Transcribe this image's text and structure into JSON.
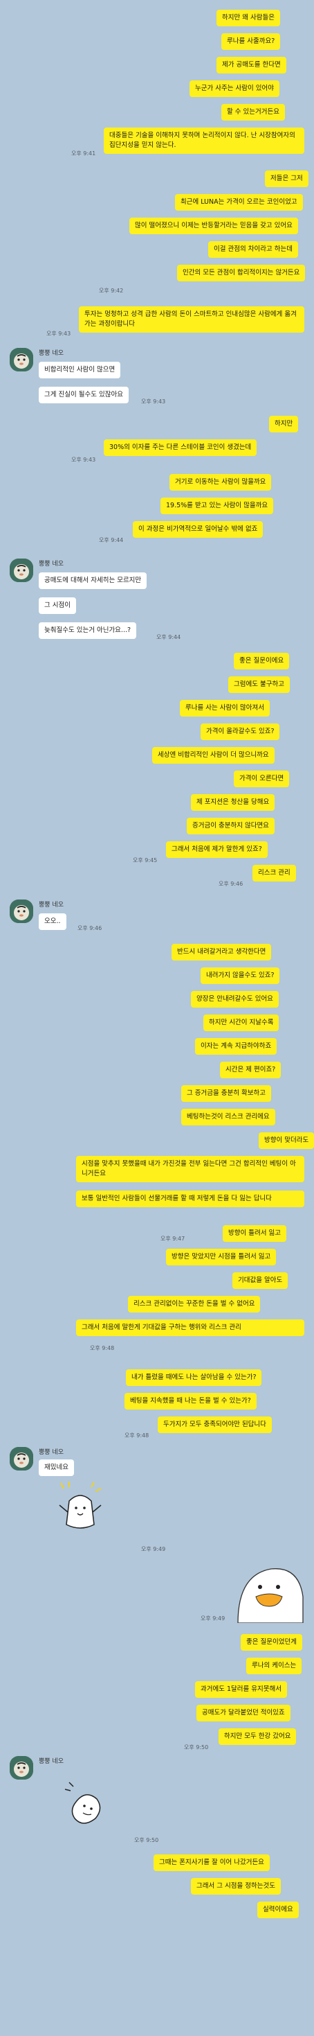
{
  "sender_name": "뿡뿡 네오",
  "times": {
    "t941": "오후 9:41",
    "t942": "오후 9:42",
    "t943": "오후 9:43",
    "t944": "오후 9:44",
    "t945": "오후 9:45",
    "t946": "오후 9:46",
    "t947": "오후 9:47",
    "t948": "오후 9:48",
    "t949": "오후 9:49",
    "t950": "오후 9:50"
  },
  "messages": {
    "m1": "하지만 왜 사람들은",
    "m2": "루나를 사줄까요?",
    "m3": "제가 공매도를 한다면",
    "m4": "누군가 사주는 사람이 있어야",
    "m5": "할 수 있는거거든요",
    "m6": "대중들은 기술을 이해하지 못하며 논리적이지 않다. 난 시장참여자의 집단지성을 믿지 않는다.",
    "m7": "저들은 그저",
    "m8": "최근에 LUNA는 가격이 오르는 코인이었고",
    "m9": "많이 떨어졌으니 이제는 반등할거라는 믿음을 갖고 있어요",
    "m10": "이걸 관점의 차이라고 하는데",
    "m11": "인간의 모든 관점이 합리적이지는 않거든요",
    "m12": "투자는 멍청하고 성격 급한 사람의 돈이 스마트하고 인내심많은 사람에게 옮겨가는 과정이랍니다",
    "o1": "비합리적인 사람이 많으면",
    "o2": "그게 진실이 될수도 있잖아요",
    "m13": "하지만",
    "m14": "30%의 이자를 주는 다른 스테이블 코인이 생겼는데",
    "m15": "거기로 이동하는 사람이 많을까요",
    "m16": "19.5%를 받고 있는 사람이 많을까요",
    "m17": "이 과정은 비가역적으로 일어날수 밖에 없죠",
    "o3": "공매도에 대해서 자세히는 모르지만",
    "o4": "그 시점이",
    "o5": "늦춰질수도 있는거 아닌가요...?",
    "m18": "좋은 질문이에요",
    "m19": "그럼에도 불구하고",
    "m20": "루나를 사는 사람이 많아져서",
    "m21": "가격이 올라갈수도 있죠?",
    "m22": "세상엔 비합리적인 사람이 더 많으니까요",
    "m23": "가격이 오른다면",
    "m24": "제 포지션은 청산을 당해요",
    "m25": "증거금이 충분하지 않다면요",
    "m26": "그래서 처음에 제가 말한게 있죠?",
    "m27": "리스크 관리",
    "o6": "오오..",
    "m28": "반드시 내려갈거라고 생각한다면",
    "m29": "내려가지 않을수도 있죠?",
    "m30": "양장은 안내려갈수도 있어요",
    "m31": "하지만 시간이 지날수록",
    "m32": "이자는 계속 지급하야하죠",
    "m33": "시간은 제 편이죠?",
    "m34": "그 증거금을 충분히 확보하고",
    "m35": "베팅하는것이 리스크 관리에요",
    "m36": "방향이 맞더라도",
    "m37": "시점을 맞추지 못했을때 내가 가진것을 전부 잃는다면 그건 합리적인 베팅이 아니거든요",
    "m38": "보통 일반적인 사람들이 선물거래를 할 때 저렇게 돈을 다 잃는 답니다",
    "m39": "방향이 틀려서 잃고",
    "m40": "방향은 맞았지만 시점을 틀려서 잃고",
    "m41": "기대값을 알아도",
    "m42": "리스크 관리없이는 꾸준한 돈을 벌 수 없어요",
    "m43": "그래서 처음에 말한게 기대값을 구하는 행위와 리스크 관리",
    "m44": "내가 틀렸을 때에도 나는 살아남을 수 있는가?",
    "m45": "베팅을 지속했을 때 나는 돈을 벌 수 있는가?",
    "m46": "두가지가 모두 충족되어야만 된답니다",
    "o7": "재밌네요",
    "m47": "좋은 질문이었던게",
    "m48": "루나의 케이스는",
    "m49": "과거에도 1달러를 유지못해서",
    "m50": "공매도가 달라붙었던 적이있죠",
    "m51": "하지만 모두 한강 갔어요",
    "m52": "그때는 폰지사기를 잘 이어 나갔거든요",
    "m53": "그래서 그 시점을 정하는것도",
    "m54": "실력이에요"
  }
}
